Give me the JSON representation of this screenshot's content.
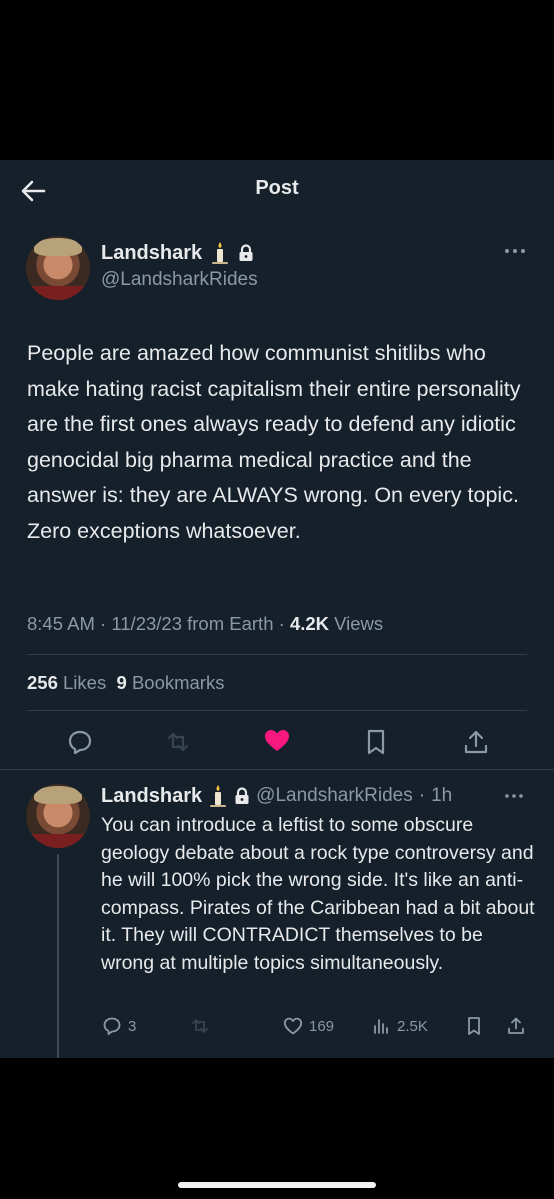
{
  "header": {
    "title": "Post"
  },
  "tweet": {
    "name": "Landshark",
    "handle": "@LandsharkRides",
    "text": "People are amazed how communist shitlibs who make hating racist capitalism their entire personality are the first ones always ready to defend any idiotic genocidal big pharma medical practice and the answer is: they are ALWAYS wrong. On every topic. Zero exceptions whatsoever.",
    "time": "8:45 AM",
    "date": "11/23/23",
    "source": "from Earth",
    "views_count": "4.2K",
    "views_label": "Views",
    "likes_count": "256",
    "likes_label": "Likes",
    "bookmarks_count": "9",
    "bookmarks_label": "Bookmarks",
    "liked": true
  },
  "reply": {
    "name": "Landshark",
    "handle": "@LandsharkRides",
    "age": "1h",
    "text": "You can introduce a leftist to some obscure geology debate about a rock type controversy and he will 100% pick the wrong side. It's like an anti-compass. Pirates of the Caribbean had a bit about it. They will CONTRADICT themselves to be wrong at multiple topics simultaneously.",
    "replies": "3",
    "likes": "169",
    "views": "2.5K"
  },
  "colors": {
    "background": "#15202b",
    "like_active": "#f91880",
    "muted": "#8b98a5",
    "divider": "#2f3b47"
  },
  "icons": [
    "back-arrow-icon",
    "candle-icon",
    "lock-icon",
    "more-icon",
    "reply-icon",
    "retweet-icon",
    "heart-icon",
    "bookmark-icon",
    "share-icon",
    "views-icon"
  ]
}
